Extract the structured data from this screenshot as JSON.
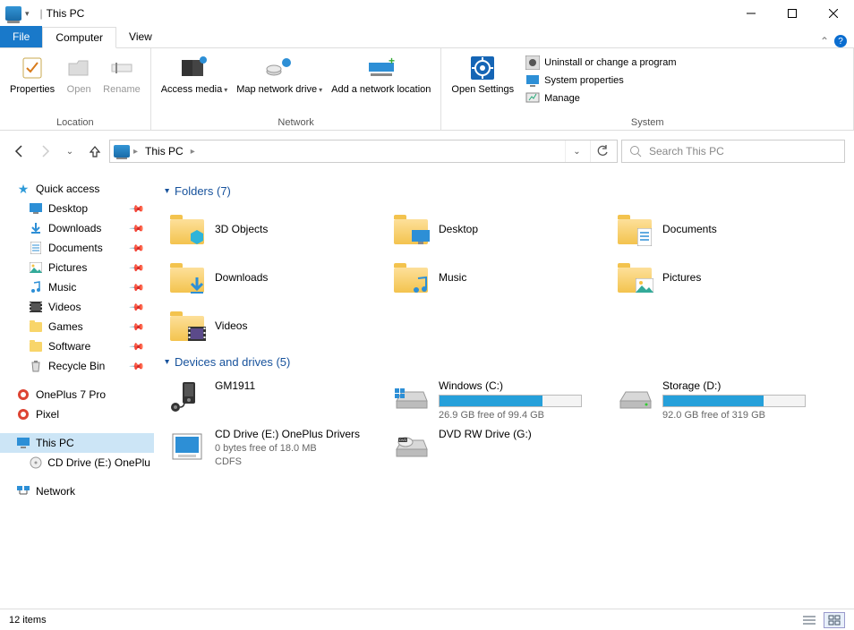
{
  "titlebar": {
    "title": "This PC"
  },
  "tabs": {
    "file": "File",
    "computer": "Computer",
    "view": "View"
  },
  "ribbon": {
    "location": {
      "label": "Location",
      "properties": "Properties",
      "open": "Open",
      "rename": "Rename"
    },
    "network": {
      "label": "Network",
      "access_media": "Access media",
      "map_drive": "Map network drive",
      "add_location": "Add a network location"
    },
    "open_settings": "Open Settings",
    "system": {
      "label": "System",
      "uninstall": "Uninstall or change a program",
      "props": "System properties",
      "manage": "Manage"
    }
  },
  "breadcrumb": {
    "root": "This PC"
  },
  "search": {
    "placeholder": "Search This PC"
  },
  "sidebar": {
    "quick_access": "Quick access",
    "pins": [
      {
        "label": "Desktop"
      },
      {
        "label": "Downloads"
      },
      {
        "label": "Documents"
      },
      {
        "label": "Pictures"
      },
      {
        "label": "Music"
      },
      {
        "label": "Videos"
      },
      {
        "label": "Games"
      },
      {
        "label": "Software"
      },
      {
        "label": "Recycle Bin"
      }
    ],
    "items": [
      {
        "label": "OnePlus 7 Pro"
      },
      {
        "label": "Pixel"
      }
    ],
    "this_pc": "This PC",
    "cd": "CD Drive (E:) OnePlus",
    "network": "Network"
  },
  "sections": {
    "folders": "Folders (7)",
    "drives": "Devices and drives (5)"
  },
  "folders": [
    {
      "label": "3D Objects"
    },
    {
      "label": "Desktop"
    },
    {
      "label": "Documents"
    },
    {
      "label": "Downloads"
    },
    {
      "label": "Music"
    },
    {
      "label": "Pictures"
    },
    {
      "label": "Videos"
    }
  ],
  "drives": [
    {
      "name": "GM1911",
      "type": "device"
    },
    {
      "name": "Windows (C:)",
      "type": "hdd",
      "free": "26.9 GB free of 99.4 GB",
      "pct": 73
    },
    {
      "name": "Storage (D:)",
      "type": "hdd",
      "free": "92.0 GB free of 319 GB",
      "pct": 71
    },
    {
      "name": "CD Drive (E:) OnePlus Drivers",
      "type": "cd",
      "free": "0 bytes free of 18.0 MB",
      "fs": "CDFS"
    },
    {
      "name": "DVD RW Drive (G:)",
      "type": "dvd"
    }
  ],
  "status": {
    "count": "12 items"
  }
}
